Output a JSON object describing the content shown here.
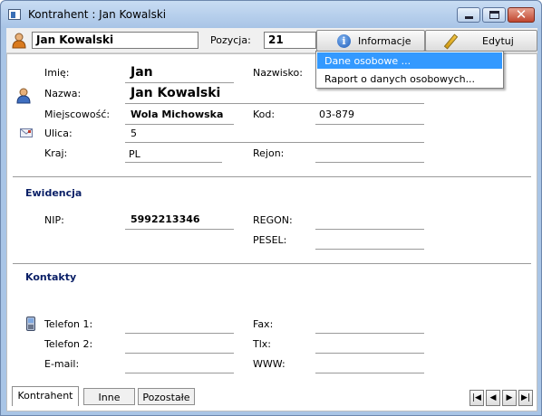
{
  "window": {
    "title": "Kontrahent : Jan Kowalski"
  },
  "toolbar": {
    "name_value": "Jan Kowalski",
    "position_label": "Pozycja:",
    "position_value": "21",
    "info_label": "Informacje",
    "edit_label": "Edytuj"
  },
  "dropdown": {
    "items": [
      "Dane osobowe ...",
      "Raport o danych osobowych..."
    ]
  },
  "personal": {
    "first_name_label": "Imię:",
    "first_name": "Jan",
    "last_name_label": "Nazwisko:",
    "name_label": "Nazwa:",
    "name": "Jan Kowalski",
    "city_label": "Miejscowość:",
    "city": "Wola Michowska",
    "postcode_label": "Kod:",
    "postcode": "03-879",
    "street_label": "Ulica:",
    "street": "5",
    "country_label": "Kraj:",
    "country": "PL",
    "region_label": "Rejon:"
  },
  "ewidencja": {
    "title": "Ewidencja",
    "nip_label": "NIP:",
    "nip": "5992213346",
    "regon_label": "REGON:",
    "pesel_label": "PESEL:"
  },
  "contacts": {
    "title": "Kontakty",
    "phone1_label": "Telefon 1:",
    "phone2_label": "Telefon 2:",
    "email_label": "E-mail:",
    "fax_label": "Fax:",
    "tlx_label": "Tlx:",
    "www_label": "WWW:"
  },
  "tabs": [
    "Kontrahent",
    "Inne",
    "Pozostałe"
  ],
  "nav": [
    "first",
    "prev",
    "next",
    "last"
  ],
  "colors": {
    "section_title": "#0a1f66",
    "menu_highlight": "#3399ff"
  }
}
